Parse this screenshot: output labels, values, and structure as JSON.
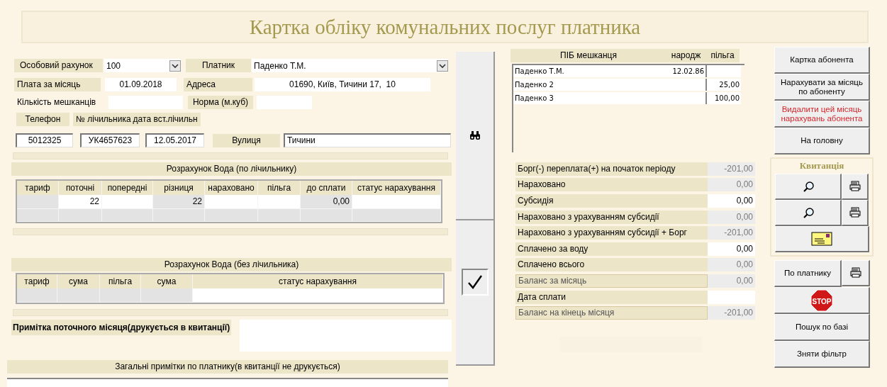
{
  "title": "Картка обліку комунальних послуг платника",
  "account": {
    "label": "Особовий рахунок",
    "value": "100"
  },
  "payer": {
    "label": "Платник",
    "value": "Паденко Т.М."
  },
  "month": {
    "label": "Плата за місяць",
    "value": "01.09.2018"
  },
  "address": {
    "label": "Адреса",
    "value": "01690, Київ, Тичини 17,  10"
  },
  "residents_count": {
    "label": "Кількість мешканців"
  },
  "norm": {
    "label": "Норма (м.куб)"
  },
  "phone": {
    "label": "Телефон",
    "value": "5012325"
  },
  "meter": {
    "label": "№ лічильника",
    "value": "УК4657623"
  },
  "meter_date": {
    "label": "дата вст.лічильн",
    "value": "12.05.2017"
  },
  "street": {
    "label": "Вулиця",
    "value": "Тичини"
  },
  "metered": {
    "title": "Розрахунок Вода (по лічильнику)",
    "columns": [
      {
        "label": "тариф",
        "locked": true
      },
      {
        "label": "поточні",
        "locked": false
      },
      {
        "label": "попередні",
        "locked": false
      },
      {
        "label": "різниця",
        "locked": true
      },
      {
        "label": "нараховано",
        "locked": false
      },
      {
        "label": "пільга",
        "locked": false
      },
      {
        "label": "до сплати",
        "locked": true
      },
      {
        "label": "статус нарахування",
        "locked": false
      }
    ],
    "row": {
      "поточні": "22",
      "різниця": "22",
      "до сплати": "0,00"
    }
  },
  "unmetered": {
    "title": "Розрахунок Вода (без лічильника)",
    "columns": [
      {
        "label": "тариф",
        "locked": true
      },
      {
        "label": "сума",
        "locked": true
      },
      {
        "label": "пільга",
        "locked": true
      },
      {
        "label": "сума",
        "locked": true
      },
      {
        "label": "статус нарахування",
        "locked": false
      }
    ]
  },
  "note_current": {
    "label": "Примітка поточного місяця(друкується в квитанції)"
  },
  "note_general": {
    "label": "Загальні примітки по платнику(в квитанції не друкується)"
  },
  "residents": {
    "columns": [
      "ПІБ мешканця",
      "народж",
      "пільга"
    ],
    "rows": [
      [
        "Паденко Т.М.",
        "12.02.86",
        null
      ],
      [
        "Паденко 2",
        null,
        "25,00"
      ],
      [
        "Паденко 3",
        null,
        "100,00"
      ]
    ]
  },
  "balances": [
    {
      "label": "Борг(-) переплата(+) на початок періоду",
      "value": "-201,00",
      "editable": false,
      "framed": false
    },
    {
      "label": "Нараховано",
      "value": "0,00",
      "editable": false,
      "framed": false
    },
    {
      "label": "Субсидія",
      "value": "0,00",
      "editable": true,
      "framed": false
    },
    {
      "label": "Нараховано з урахуванням субсидії",
      "value": "0,00",
      "editable": false,
      "framed": false
    },
    {
      "label": "Нараховано з урахуванням субсидії + Борг",
      "value": "-201,00",
      "editable": false,
      "framed": false
    },
    {
      "label": "Сплачено за воду",
      "value": "0,00",
      "editable": true,
      "framed": false
    },
    {
      "label": "Сплачено всього",
      "value": "0,00",
      "editable": false,
      "framed": false
    },
    {
      "label": "Баланс за місяць",
      "value": "0,00",
      "editable": false,
      "framed": true
    },
    {
      "label": "Дата сплати",
      "editable": true,
      "framed": false
    },
    {
      "label": "Баланс на кінець місяця",
      "value": "-201,00",
      "editable": false,
      "framed": true
    }
  ],
  "top_buttons": [
    {
      "label": "Картка абонента",
      "danger": false
    },
    {
      "label": "Нарахувати за місяць по абоненту",
      "danger": false
    },
    {
      "label": "Видалити цей місяць нарахувань абонента",
      "danger": true
    },
    {
      "label": "На головну",
      "danger": false
    }
  ],
  "receipt": {
    "title": "Квитанція"
  },
  "payer_button": {
    "label": "По платнику"
  },
  "stop_button": {
    "sign": "STOP"
  },
  "bottom_buttons": [
    "Пошук по базі",
    "Зняти фільтр"
  ]
}
